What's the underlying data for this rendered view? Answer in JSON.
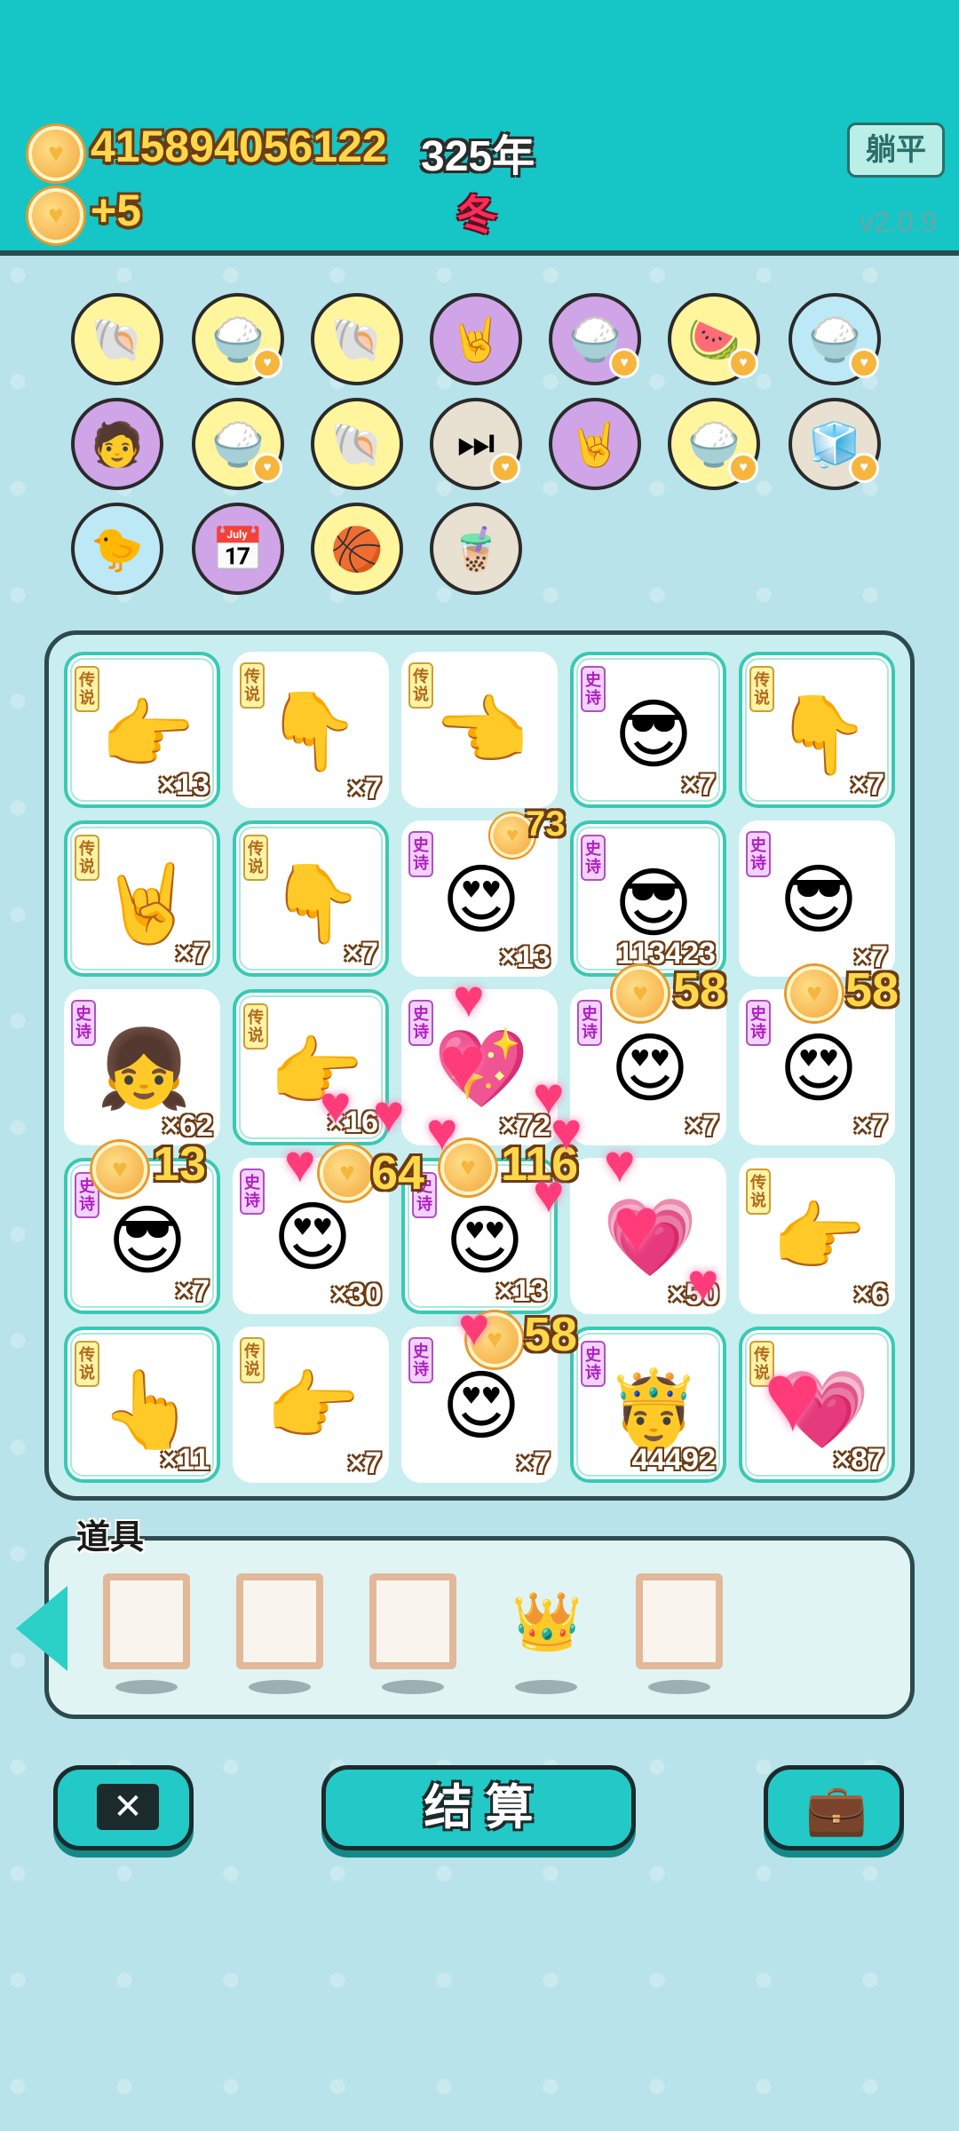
{
  "header": {
    "coins": "415894056122",
    "year": "325年",
    "income": "+5",
    "season": "冬",
    "lie_ping_label": "躺平",
    "version": "v2.0.9"
  },
  "items": [
    {
      "icon": "shell-icon",
      "glyph": "🐚",
      "color": "y",
      "badge": false
    },
    {
      "icon": "rice-bowl-icon",
      "glyph": "🍚",
      "color": "y",
      "badge": true
    },
    {
      "icon": "shell-icon",
      "glyph": "🐚",
      "color": "y",
      "badge": false
    },
    {
      "icon": "rock-hand-icon",
      "glyph": "🤘",
      "color": "p",
      "badge": false
    },
    {
      "icon": "rice-bowl-icon",
      "glyph": "🍚",
      "color": "p",
      "badge": true
    },
    {
      "icon": "fruit-basket-icon",
      "glyph": "🍉",
      "color": "y",
      "badge": true
    },
    {
      "icon": "rice-bowl-icon",
      "glyph": "🍚",
      "color": "b",
      "badge": true
    },
    {
      "icon": "math-man-icon",
      "glyph": "🧑",
      "color": "p",
      "badge": false
    },
    {
      "icon": "rice-bowl-icon",
      "glyph": "🍚",
      "color": "y",
      "badge": true
    },
    {
      "icon": "shell-icon",
      "glyph": "🐚",
      "color": "y",
      "badge": false
    },
    {
      "icon": "skip-icon",
      "glyph": "⏭",
      "color": "g",
      "badge": true
    },
    {
      "icon": "rock-hand-icon",
      "glyph": "🤘",
      "color": "p",
      "badge": false
    },
    {
      "icon": "rice-bowl-icon",
      "glyph": "🍚",
      "color": "y",
      "badge": true
    },
    {
      "icon": "sugar-cubes-icon",
      "glyph": "🧊",
      "color": "g",
      "badge": true
    },
    {
      "icon": "chick-egg-icon",
      "glyph": "🐤",
      "color": "b",
      "badge": false
    },
    {
      "icon": "calendar-icon",
      "glyph": "📅",
      "color": "p",
      "badge": false
    },
    {
      "icon": "basketballs-icon",
      "glyph": "🏀",
      "color": "y",
      "badge": false
    },
    {
      "icon": "milk-tea-icon",
      "glyph": "🧋",
      "color": "g",
      "badge": false
    }
  ],
  "board": [
    {
      "tag": "传说",
      "type": "leg",
      "art": "👉",
      "count": "×13",
      "framed": true
    },
    {
      "tag": "传说",
      "type": "leg",
      "art": "👇",
      "count": "×7",
      "framed": false
    },
    {
      "tag": "传说",
      "type": "leg",
      "art": "👈",
      "count": "",
      "framed": false
    },
    {
      "tag": "史诗",
      "type": "epic",
      "art": "😎",
      "count": "×7",
      "framed": true
    },
    {
      "tag": "传说",
      "type": "leg",
      "art": "👇",
      "count": "×7",
      "framed": true
    },
    {
      "tag": "传说",
      "type": "leg",
      "art": "🤘",
      "count": "×7",
      "framed": true
    },
    {
      "tag": "传说",
      "type": "leg",
      "art": "👇",
      "count": "×7",
      "framed": true
    },
    {
      "tag": "史诗",
      "type": "epic",
      "art": "😍",
      "count": "×13",
      "framed": false
    },
    {
      "tag": "史诗",
      "type": "epic",
      "art": "😎",
      "count": "113423",
      "framed": true
    },
    {
      "tag": "史诗",
      "type": "epic",
      "art": "😎",
      "count": "×7",
      "framed": false
    },
    {
      "tag": "史诗",
      "type": "epic",
      "art": "👧",
      "count": "×62",
      "framed": false
    },
    {
      "tag": "传说",
      "type": "leg",
      "art": "👉",
      "count": "×16",
      "framed": true
    },
    {
      "tag": "史诗",
      "type": "epic",
      "art": "💖",
      "count": "×72",
      "framed": false
    },
    {
      "tag": "史诗",
      "type": "epic",
      "art": "😍",
      "count": "×7",
      "framed": false
    },
    {
      "tag": "史诗",
      "type": "epic",
      "art": "😍",
      "count": "×7",
      "framed": false
    },
    {
      "tag": "史诗",
      "type": "epic",
      "art": "😎",
      "count": "×7",
      "framed": true
    },
    {
      "tag": "史诗",
      "type": "epic",
      "art": "😍",
      "count": "×30",
      "framed": false
    },
    {
      "tag": "史诗",
      "type": "epic",
      "art": "😍",
      "count": "×13",
      "framed": true
    },
    {
      "tag": "",
      "type": "epic",
      "art": "💗",
      "count": "×50",
      "framed": false
    },
    {
      "tag": "传说",
      "type": "leg",
      "art": "👉",
      "count": "×6",
      "framed": false
    },
    {
      "tag": "传说",
      "type": "leg",
      "art": "👆",
      "count": "×11",
      "framed": true
    },
    {
      "tag": "传说",
      "type": "leg",
      "art": "👉",
      "count": "×7",
      "framed": false
    },
    {
      "tag": "史诗",
      "type": "epic",
      "art": "😍",
      "count": "×7",
      "framed": false
    },
    {
      "tag": "史诗",
      "type": "epic",
      "art": "🤴",
      "count": "44492",
      "framed": true
    },
    {
      "tag": "传说",
      "type": "leg",
      "art": "💗",
      "count": "×87",
      "framed": true
    }
  ],
  "floats": {
    "f1": "73",
    "f2": "58",
    "f3": "58",
    "f4": "13",
    "f5": "64",
    "f6": "116",
    "f7": "58"
  },
  "props": {
    "title": "道具",
    "slots": [
      "empty-frame",
      "empty-frame",
      "empty-frame",
      "crown",
      "empty-frame"
    ]
  },
  "buttons": {
    "settle_label": "结 算"
  }
}
